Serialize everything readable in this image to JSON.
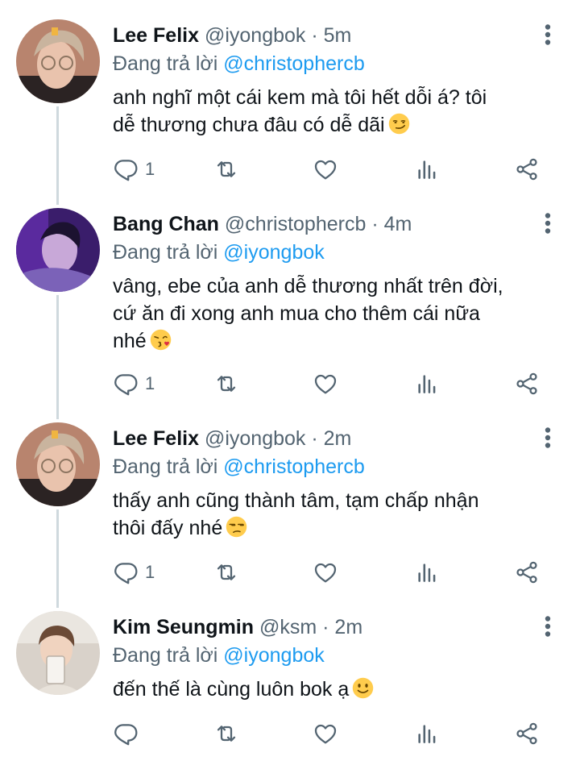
{
  "tweets": [
    {
      "name": "Lee Felix",
      "handle": "@iyongbok",
      "separator": "·",
      "time": "5m",
      "reply_prefix": "Đang trả lời",
      "reply_to": "@christophercb",
      "lines": [
        "anh nghĩ một cái kem mà tôi hết dỗi á? tôi",
        "dễ thương chưa đâu có dễ dãi"
      ],
      "emoji": "smirking-face",
      "reply_count": "1"
    },
    {
      "name": "Bang Chan",
      "handle": "@christophercb",
      "separator": "·",
      "time": "4m",
      "reply_prefix": "Đang trả lời",
      "reply_to": "@iyongbok",
      "lines": [
        "vâng, ebe của anh dễ thương nhất trên đời,",
        "cứ ăn đi xong anh mua cho thêm cái nữa",
        "nhé"
      ],
      "emoji": "face-blowing-kiss",
      "reply_count": "1"
    },
    {
      "name": "Lee Felix",
      "handle": "@iyongbok",
      "separator": "·",
      "time": "2m",
      "reply_prefix": "Đang trả lời",
      "reply_to": "@christophercb",
      "lines": [
        "thấy anh cũng thành tâm, tạm chấp nhận",
        "thôi đấy nhé"
      ],
      "emoji": "unamused-face",
      "reply_count": "1"
    },
    {
      "name": "Kim Seungmin",
      "handle": "@ksm",
      "separator": "·",
      "time": "2m",
      "reply_prefix": "Đang trả lời",
      "reply_to": "@iyongbok",
      "lines": [
        "đến thế là cùng luôn bok ạ"
      ],
      "emoji": "slightly-smiling-face",
      "reply_count": ""
    }
  ],
  "icons": {
    "reply": "reply-icon",
    "retweet": "retweet-icon",
    "like": "heart-icon",
    "analytics": "analytics-icon",
    "share": "share-icon",
    "more": "more-vertical-icon"
  },
  "colors": {
    "text": "#0f1419",
    "muted": "#536471",
    "link": "#1d9bf0",
    "thread_line": "#cfd9de"
  }
}
